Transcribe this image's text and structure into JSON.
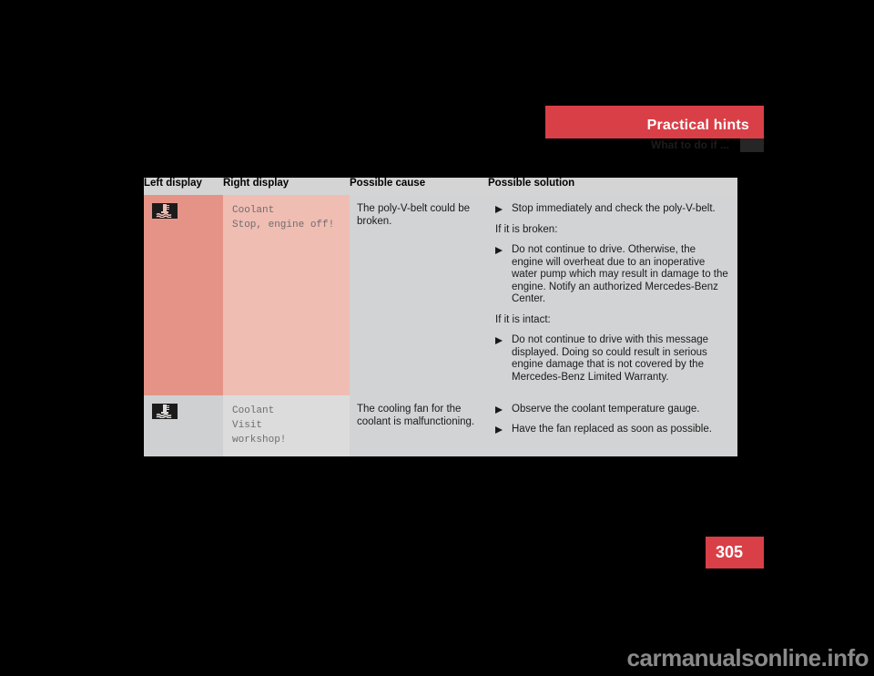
{
  "header": {
    "section_title": "Practical hints",
    "subsection_title": "What to do if ...",
    "accent_color": "#d93f47"
  },
  "table": {
    "columns": [
      "Left display",
      "Right display",
      "Possible cause",
      "Possible solution"
    ],
    "rows": [
      {
        "left_display_icon": "coolant-temperature-icon",
        "right_display_lines": [
          "Coolant",
          "Stop, engine off!"
        ],
        "possible_cause": "The poly-V-belt could be broken.",
        "solution_blocks": [
          {
            "kind": "bullet",
            "text": "Stop immediately and check the poly-V-belt."
          },
          {
            "kind": "note",
            "text": "If it is broken:"
          },
          {
            "kind": "bullet",
            "text": "Do not continue to drive. Otherwise, the engine will overheat due to an inoperative water pump which may result in damage to the engine. Notify an authorized Mercedes-Benz Center."
          },
          {
            "kind": "note",
            "text": "If it is intact:"
          },
          {
            "kind": "bullet",
            "text": "Do not continue to drive with this message displayed. Doing so could result in serious engine damage that is not covered by the Mercedes-Benz Limited Warranty."
          }
        ]
      },
      {
        "left_display_icon": "coolant-temperature-icon",
        "right_display_lines": [
          "Coolant",
          "Visit",
          "workshop!"
        ],
        "possible_cause": "The cooling fan for the coolant is malfunctioning.",
        "solution_blocks": [
          {
            "kind": "bullet",
            "text": "Observe the coolant temperature gauge."
          },
          {
            "kind": "bullet",
            "text": "Have the fan replaced as soon as possible."
          }
        ]
      }
    ]
  },
  "page": {
    "number": "305"
  },
  "watermark": {
    "text": "carmanualsonline.info"
  }
}
